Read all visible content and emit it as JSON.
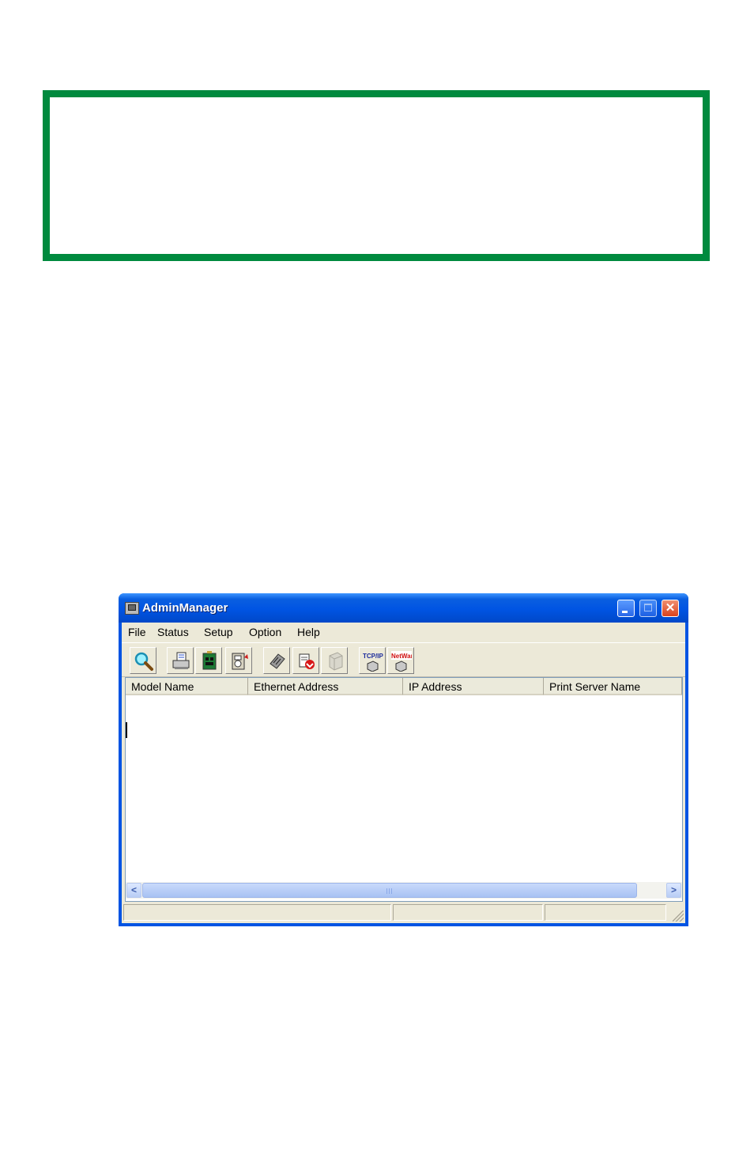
{
  "window": {
    "title": "AdminManager",
    "title_bar_color": "#0054e3"
  },
  "menu": {
    "items": [
      "File",
      "Status",
      "Setup",
      "Option",
      "Help"
    ]
  },
  "toolbar": {
    "buttons": [
      {
        "icon": "search-magnifier-icon"
      },
      {
        "icon": "printer-status-icon"
      },
      {
        "icon": "network-card-icon"
      },
      {
        "icon": "meter-icon"
      },
      {
        "icon": "firmware-chip-icon"
      },
      {
        "icon": "download-icon"
      },
      {
        "icon": "printer-disabled-icon"
      },
      {
        "icon": "tcpip-icon",
        "text": "TCP/IP"
      },
      {
        "icon": "netware-icon",
        "text": "NetWare"
      }
    ]
  },
  "table": {
    "columns": [
      "Model Name",
      "Ethernet Address",
      "IP Address",
      "Print Server Name"
    ],
    "rows": []
  },
  "scrollbar": {
    "left_arrow": "<",
    "right_arrow": ">"
  },
  "colors": {
    "frame_border": "#008a3e",
    "window_background": "#ece9d8"
  }
}
